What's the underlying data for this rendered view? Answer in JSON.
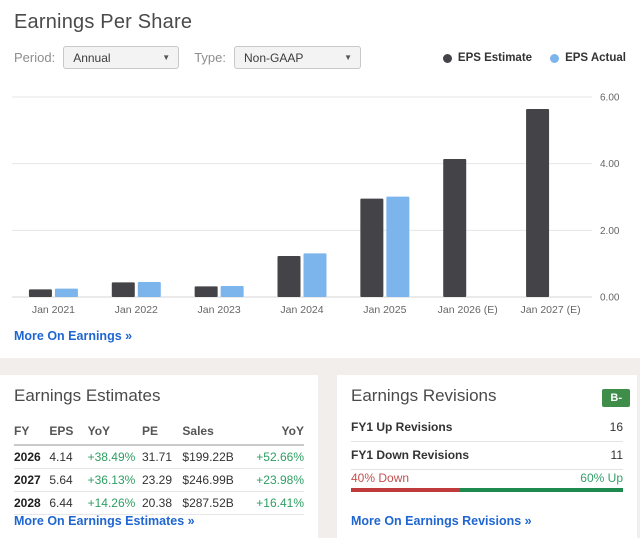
{
  "icons": {
    "dropdown_caret": "▼"
  },
  "eps_panel": {
    "title": "Earnings Per Share",
    "period_label": "Period:",
    "period_value": "Annual",
    "type_label": "Type:",
    "type_value": "Non-GAAP",
    "legend": [
      {
        "label": "EPS Estimate",
        "color": "#434348"
      },
      {
        "label": "EPS Actual",
        "color": "#7cb5ec"
      }
    ],
    "more_link": "More On Earnings »"
  },
  "chart_data": {
    "type": "bar",
    "title": "Earnings Per Share",
    "categories": [
      "Jan 2021",
      "Jan 2022",
      "Jan 2023",
      "Jan 2024",
      "Jan 2025",
      "Jan 2026 (E)",
      "Jan 2027 (E)"
    ],
    "series": [
      {
        "name": "EPS Estimate",
        "color": "#434348",
        "values": [
          0.23,
          0.44,
          0.32,
          1.23,
          2.95,
          4.14,
          5.64
        ]
      },
      {
        "name": "EPS Actual",
        "color": "#7cb5ec",
        "values": [
          0.25,
          0.45,
          0.33,
          1.31,
          3.01,
          null,
          null
        ]
      }
    ],
    "xlabel": "",
    "ylabel": "",
    "ylim": [
      0,
      6
    ],
    "yticks": [
      "0.00",
      "2.00",
      "4.00",
      "6.00"
    ],
    "grid": true,
    "legend_position": "top-right"
  },
  "estimates_panel": {
    "title": "Earnings Estimates",
    "columns": [
      "FY",
      "EPS",
      "YoY",
      "PE",
      "Sales",
      "YoY"
    ],
    "rows": [
      {
        "fy": "2026",
        "eps": "4.14",
        "eps_yoy": "+38.49%",
        "pe": "31.71",
        "sales": "$199.22B",
        "sales_yoy": "+52.66%"
      },
      {
        "fy": "2027",
        "eps": "5.64",
        "eps_yoy": "+36.13%",
        "pe": "23.29",
        "sales": "$246.99B",
        "sales_yoy": "+23.98%"
      },
      {
        "fy": "2028",
        "eps": "6.44",
        "eps_yoy": "+14.26%",
        "pe": "20.38",
        "sales": "$287.52B",
        "sales_yoy": "+16.41%"
      }
    ],
    "positive_color": "#2e9e63",
    "more_link": "More On Earnings Estimates »"
  },
  "revisions_panel": {
    "title": "Earnings Revisions",
    "grade": "B-",
    "grade_color": "#3e8e4a",
    "rows": [
      {
        "label": "FY1 Up Revisions",
        "value": "16"
      },
      {
        "label": "FY1 Down Revisions",
        "value": "11"
      }
    ],
    "down_label": "40% Down",
    "up_label": "60% Up",
    "down_pct": 40,
    "up_pct": 60,
    "down_color": "#bf3a3a",
    "up_color": "#1e8a4f",
    "more_link": "More On Earnings Revisions »"
  }
}
